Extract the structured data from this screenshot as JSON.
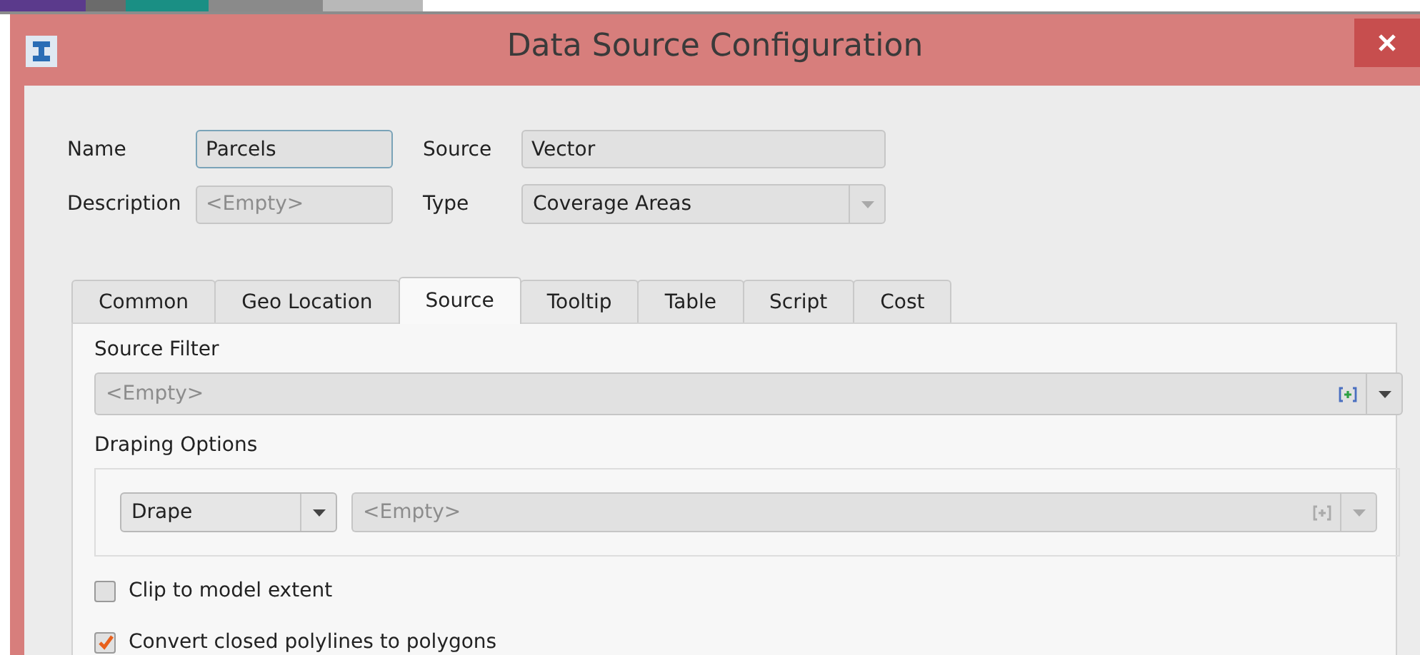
{
  "window": {
    "title": "Data Source Configuration"
  },
  "fields": {
    "name": {
      "label": "Name",
      "value": "Parcels",
      "focused": true
    },
    "source": {
      "label": "Source",
      "value": "Vector"
    },
    "description": {
      "label": "Description",
      "placeholder": "<Empty>"
    },
    "type": {
      "label": "Type",
      "value": "Coverage Areas"
    }
  },
  "tabs": [
    {
      "label": "Common",
      "selected": false
    },
    {
      "label": "Geo Location",
      "selected": false
    },
    {
      "label": "Source",
      "selected": true
    },
    {
      "label": "Tooltip",
      "selected": false
    },
    {
      "label": "Table",
      "selected": false
    },
    {
      "label": "Script",
      "selected": false
    },
    {
      "label": "Cost",
      "selected": false
    }
  ],
  "source_filter": {
    "label": "Source Filter",
    "placeholder": "<Empty>"
  },
  "draping": {
    "label": "Draping Options",
    "mode": "Drape",
    "placeholder": "<Empty>"
  },
  "options": [
    {
      "label": "Clip to model extent",
      "checked": false
    },
    {
      "label": "Convert closed polylines to polygons",
      "checked": true
    }
  ]
}
